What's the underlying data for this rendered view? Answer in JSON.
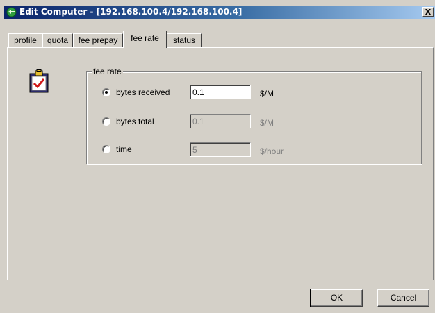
{
  "window": {
    "title": "Edit Computer - [192.168.100.4/192.168.100.4]",
    "close_label": "X"
  },
  "tabs": [
    {
      "label": "profile",
      "active": false
    },
    {
      "label": "quota",
      "active": false
    },
    {
      "label": "fee prepay",
      "active": false
    },
    {
      "label": "fee rate",
      "active": true
    },
    {
      "label": "status",
      "active": false
    }
  ],
  "fee_rate_group": {
    "legend": "fee rate",
    "options": [
      {
        "label": "bytes received",
        "checked": true,
        "value": "0.1",
        "unit": "$/M",
        "enabled": true
      },
      {
        "label": "bytes total",
        "checked": false,
        "value": "0.1",
        "unit": "$/M",
        "enabled": false
      },
      {
        "label": "time",
        "checked": false,
        "value": "5",
        "unit": "$/hour",
        "enabled": false
      }
    ]
  },
  "buttons": {
    "ok_label": "OK",
    "cancel_label": "Cancel"
  },
  "colors": {
    "titlebar_start": "#0a246a",
    "titlebar_end": "#a6caf0",
    "dialog_bg": "#d4d0c8"
  }
}
